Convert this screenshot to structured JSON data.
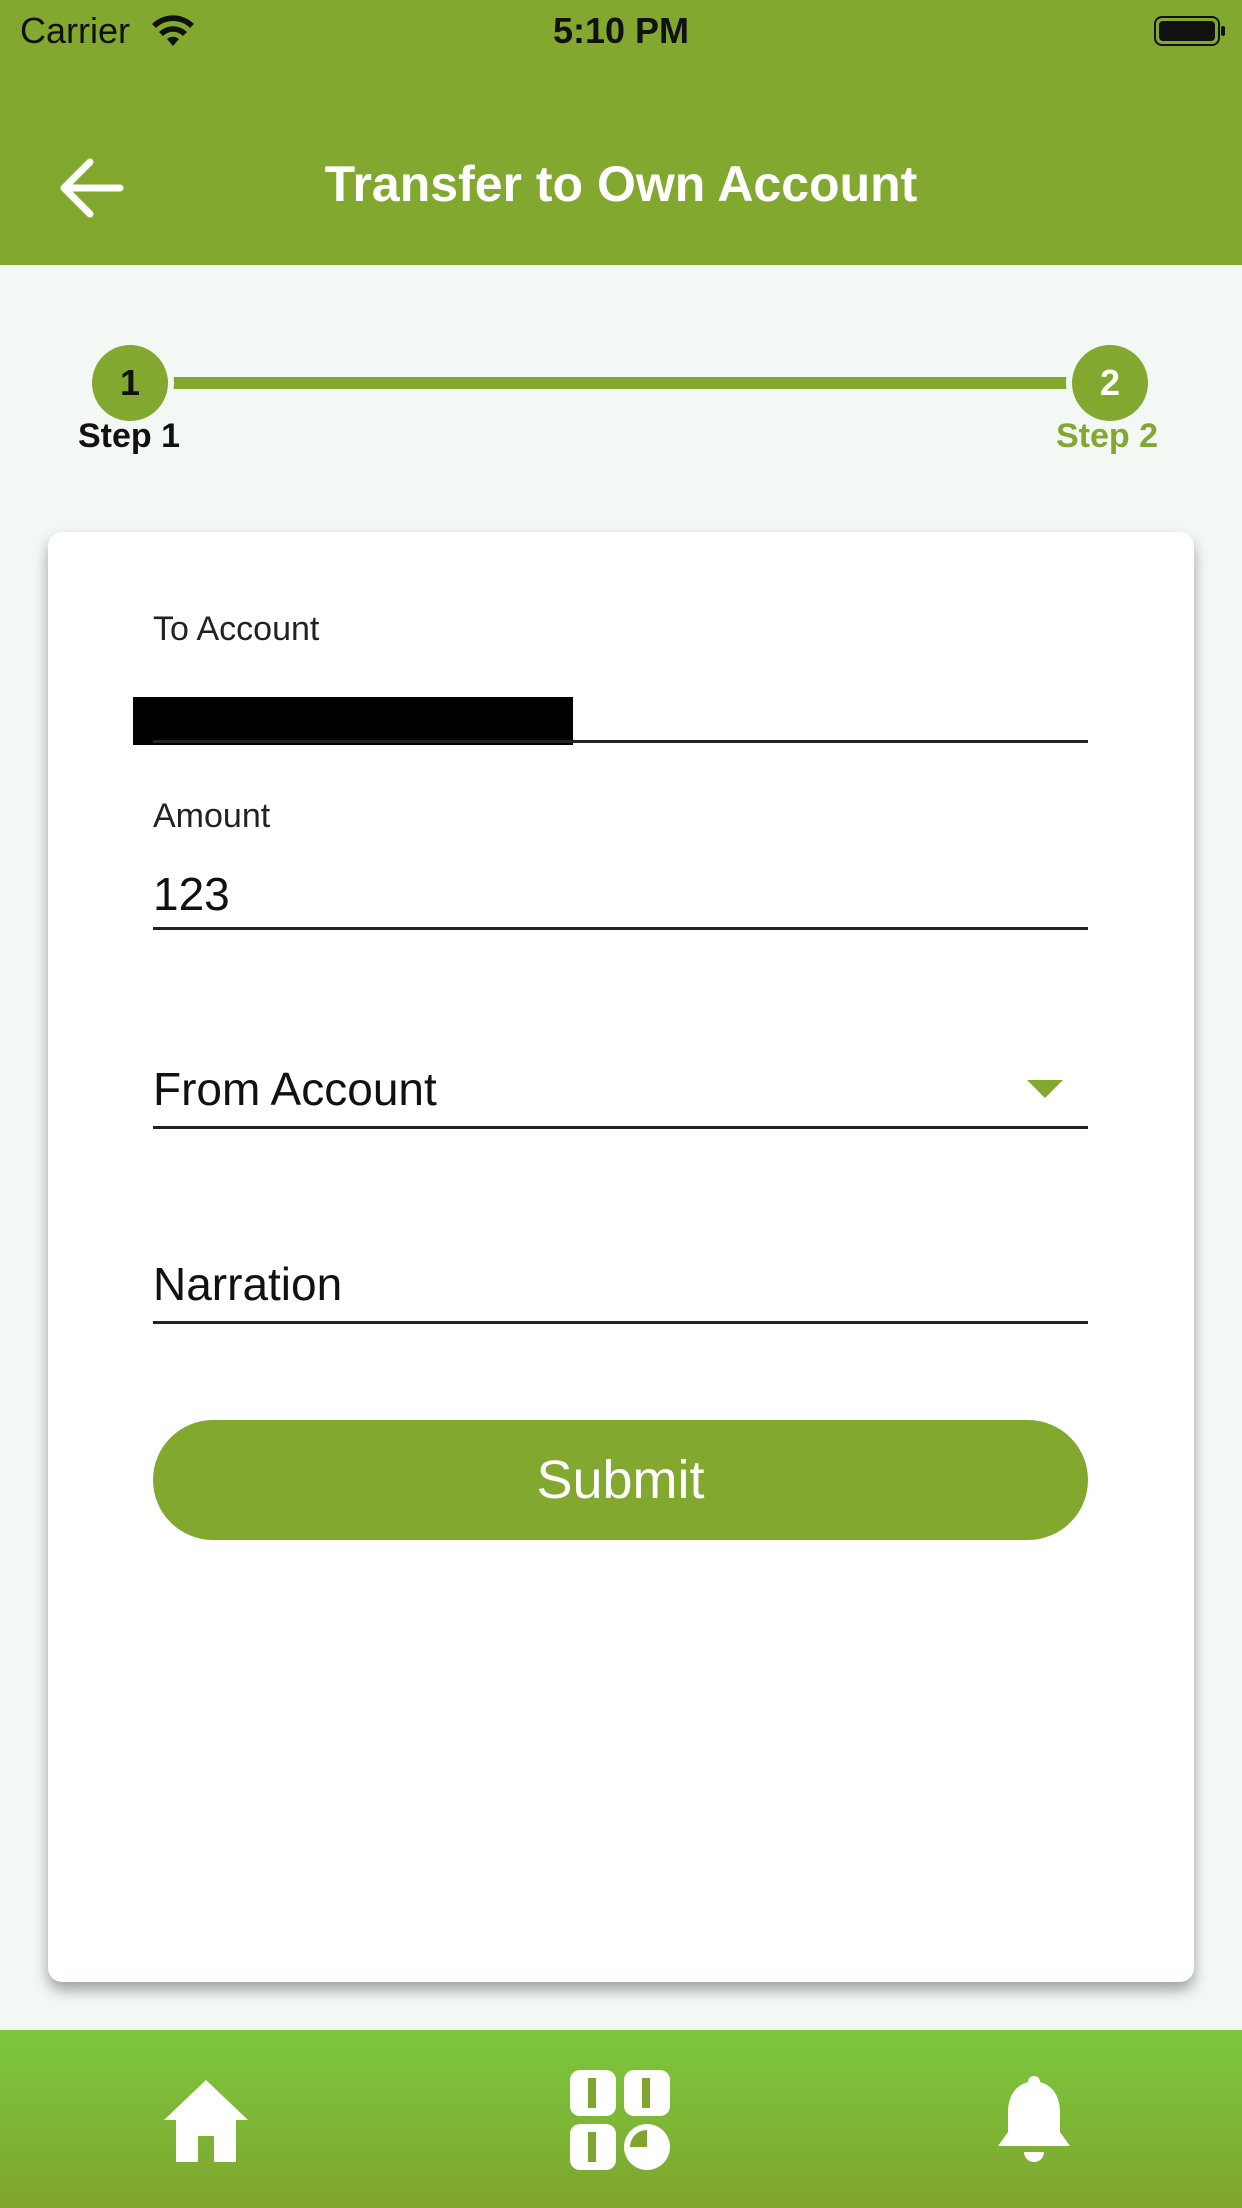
{
  "status_bar": {
    "carrier": "Carrier",
    "time": "5:10 PM"
  },
  "header": {
    "title": "Transfer to Own Account",
    "back_icon": "arrow-left-icon"
  },
  "stepper": {
    "steps": [
      {
        "number": "1",
        "label": "Step 1"
      },
      {
        "number": "2",
        "label": "Step 2"
      }
    ]
  },
  "form": {
    "to_account": {
      "label": "To Account"
    },
    "amount": {
      "label": "Amount",
      "value": "123"
    },
    "from_account": {
      "placeholder": "From Account"
    },
    "narration": {
      "placeholder": "Narration"
    },
    "submit_label": "Submit"
  },
  "tabbar": {
    "items": [
      {
        "icon": "home-icon"
      },
      {
        "icon": "services-grid-icon"
      },
      {
        "icon": "bell-icon"
      }
    ]
  },
  "colors": {
    "primary": "#82a830",
    "tabbar_top": "#7cc83e",
    "background": "#f3f8f4"
  }
}
